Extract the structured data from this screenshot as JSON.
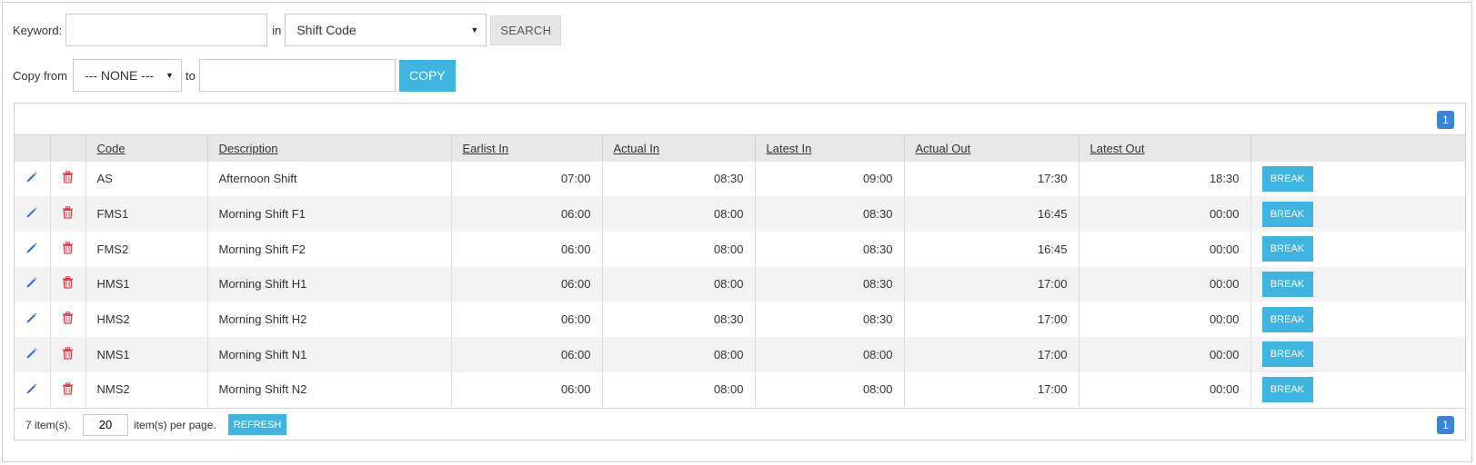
{
  "search": {
    "keyword_label": "Keyword:",
    "keyword_value": "",
    "in_label": "in",
    "field_selected": "Shift Code",
    "search_button": "SEARCH"
  },
  "copy": {
    "from_label": "Copy from",
    "from_selected": "--- NONE ---",
    "to_label": "to",
    "to_value": "",
    "copy_button": "COPY"
  },
  "pagination": {
    "current_page": "1"
  },
  "table": {
    "columns": [
      "Code",
      "Description",
      "Earlist In",
      "Actual In",
      "Latest In",
      "Actual Out",
      "Latest Out"
    ],
    "rows": [
      {
        "code": "AS",
        "description": "Afternoon Shift",
        "earliest_in": "07:00",
        "actual_in": "08:30",
        "latest_in": "09:00",
        "actual_out": "17:30",
        "latest_out": "18:30",
        "action": "BREAK"
      },
      {
        "code": "FMS1",
        "description": "Morning Shift F1",
        "earliest_in": "06:00",
        "actual_in": "08:00",
        "latest_in": "08:30",
        "actual_out": "16:45",
        "latest_out": "00:00",
        "action": "BREAK"
      },
      {
        "code": "FMS2",
        "description": "Morning Shift F2",
        "earliest_in": "06:00",
        "actual_in": "08:00",
        "latest_in": "08:30",
        "actual_out": "16:45",
        "latest_out": "00:00",
        "action": "BREAK"
      },
      {
        "code": "HMS1",
        "description": "Morning Shift H1",
        "earliest_in": "06:00",
        "actual_in": "08:00",
        "latest_in": "08:30",
        "actual_out": "17:00",
        "latest_out": "00:00",
        "action": "BREAK"
      },
      {
        "code": "HMS2",
        "description": "Morning Shift H2",
        "earliest_in": "06:00",
        "actual_in": "08:30",
        "latest_in": "08:30",
        "actual_out": "17:00",
        "latest_out": "00:00",
        "action": "BREAK"
      },
      {
        "code": "NMS1",
        "description": "Morning Shift N1",
        "earliest_in": "06:00",
        "actual_in": "08:00",
        "latest_in": "08:00",
        "actual_out": "17:00",
        "latest_out": "00:00",
        "action": "BREAK"
      },
      {
        "code": "NMS2",
        "description": "Morning Shift N2",
        "earliest_in": "06:00",
        "actual_in": "08:00",
        "latest_in": "08:00",
        "actual_out": "17:00",
        "latest_out": "00:00",
        "action": "BREAK"
      }
    ]
  },
  "footer": {
    "item_count": "7 item(s).",
    "per_page_value": "20",
    "per_page_label": "item(s) per page.",
    "refresh_button": "REFRESH"
  },
  "icons": {
    "edit": "pencil-icon",
    "delete": "trash-icon"
  },
  "colors": {
    "accent": "#40b4e0",
    "page_badge": "#3a85d6",
    "edit_icon": "#2f6fd6",
    "delete_icon": "#e0404a"
  }
}
